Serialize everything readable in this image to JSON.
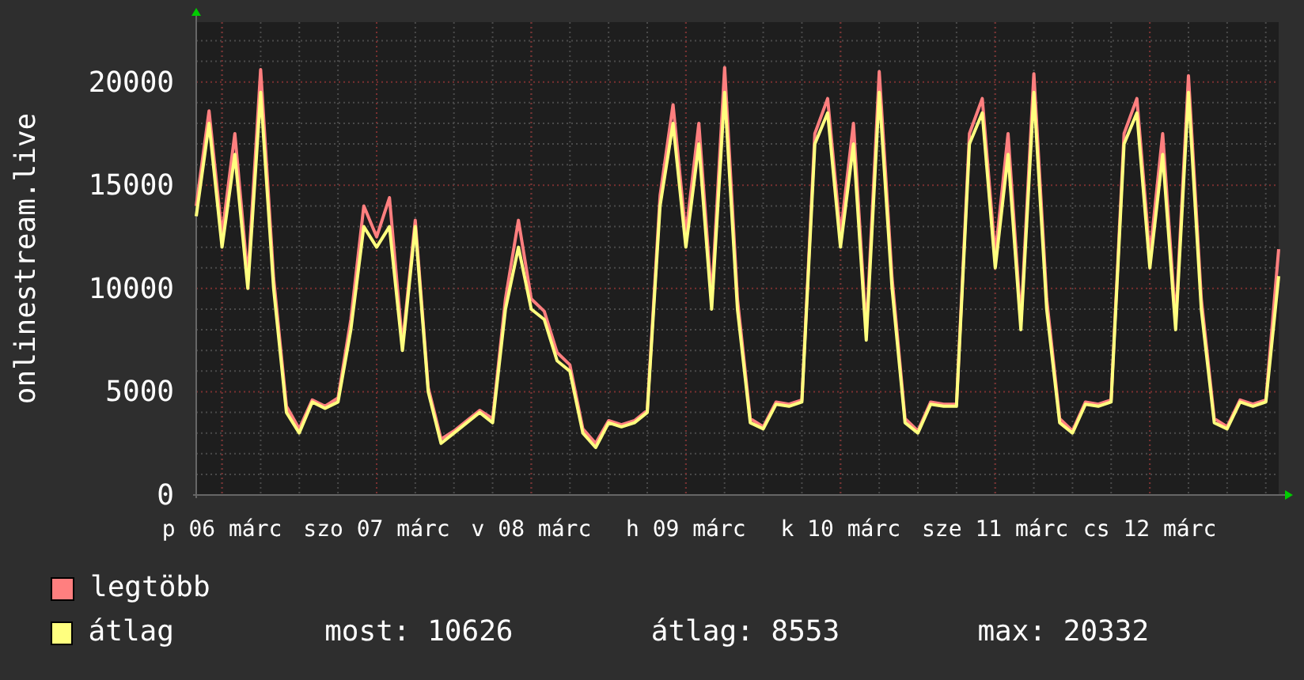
{
  "chart": {
    "chart_data": {
      "type": "line",
      "grid": true,
      "ylabel": "onlinestream.live",
      "ylim": [
        0,
        22900
      ],
      "yticks": [
        0,
        5000,
        10000,
        15000,
        20000
      ],
      "categories": [
        null,
        null,
        "p 06 márc",
        null,
        null,
        null,
        null,
        null,
        null,
        null,
        null,
        null,
        null,
        null,
        "szo 07 márc",
        null,
        null,
        null,
        null,
        null,
        null,
        null,
        null,
        null,
        null,
        null,
        "v 08 márc",
        null,
        null,
        null,
        null,
        null,
        null,
        null,
        null,
        null,
        null,
        null,
        "h 09 márc",
        null,
        null,
        null,
        null,
        null,
        null,
        null,
        null,
        null,
        null,
        null,
        "k 10 márc",
        null,
        null,
        null,
        null,
        null,
        null,
        null,
        null,
        null,
        null,
        null,
        "sze 11 márc",
        null,
        null,
        null,
        null,
        null,
        null,
        null,
        null,
        null,
        null,
        null,
        "cs 12 márc",
        null,
        null,
        null,
        null,
        null,
        null,
        null,
        null,
        null,
        null
      ],
      "series": [
        {
          "name": "legtöbb",
          "color": "#ff7f7f",
          "values": [
            14000,
            18600,
            12600,
            17500,
            10500,
            20600,
            10500,
            4300,
            3200,
            4600,
            4300,
            4700,
            8500,
            14000,
            12500,
            14400,
            7300,
            13300,
            5200,
            2700,
            3100,
            3600,
            4100,
            3700,
            9500,
            13300,
            9500,
            8900,
            6900,
            6300,
            3200,
            2500,
            3600,
            3400,
            3600,
            4100,
            14500,
            18900,
            12600,
            18000,
            9500,
            20700,
            9500,
            3700,
            3300,
            4500,
            4400,
            4600,
            17500,
            19200,
            12600,
            18000,
            7900,
            20500,
            10500,
            3700,
            3100,
            4500,
            4400,
            4400,
            17500,
            19200,
            11600,
            17500,
            8400,
            20400,
            9500,
            3700,
            3100,
            4500,
            4400,
            4600,
            17500,
            19200,
            11600,
            17500,
            8400,
            20300,
            9500,
            3700,
            3300,
            4600,
            4400,
            4600,
            11900
          ]
        },
        {
          "name": "átlag",
          "color": "#ffff7f",
          "values": [
            13500,
            18000,
            12000,
            16500,
            10000,
            19500,
            10000,
            4000,
            3000,
            4500,
            4200,
            4500,
            8000,
            13000,
            12000,
            13000,
            7000,
            13000,
            5000,
            2500,
            3000,
            3500,
            4000,
            3500,
            9000,
            12000,
            9000,
            8500,
            6500,
            6000,
            3000,
            2300,
            3500,
            3300,
            3500,
            4000,
            14000,
            18000,
            12000,
            17000,
            9000,
            19500,
            9000,
            3500,
            3200,
            4400,
            4300,
            4500,
            17000,
            18500,
            12000,
            17000,
            7500,
            19500,
            10000,
            3500,
            3000,
            4400,
            4300,
            4300,
            17000,
            18500,
            11000,
            16500,
            8000,
            19500,
            9000,
            3500,
            3000,
            4400,
            4300,
            4500,
            17000,
            18500,
            11000,
            16500,
            8000,
            19500,
            9000,
            3500,
            3200,
            4500,
            4300,
            4500,
            10600
          ]
        }
      ]
    }
  },
  "legend_stats": [
    "most: 10626",
    "átlag: 8553",
    "max: 20332"
  ]
}
